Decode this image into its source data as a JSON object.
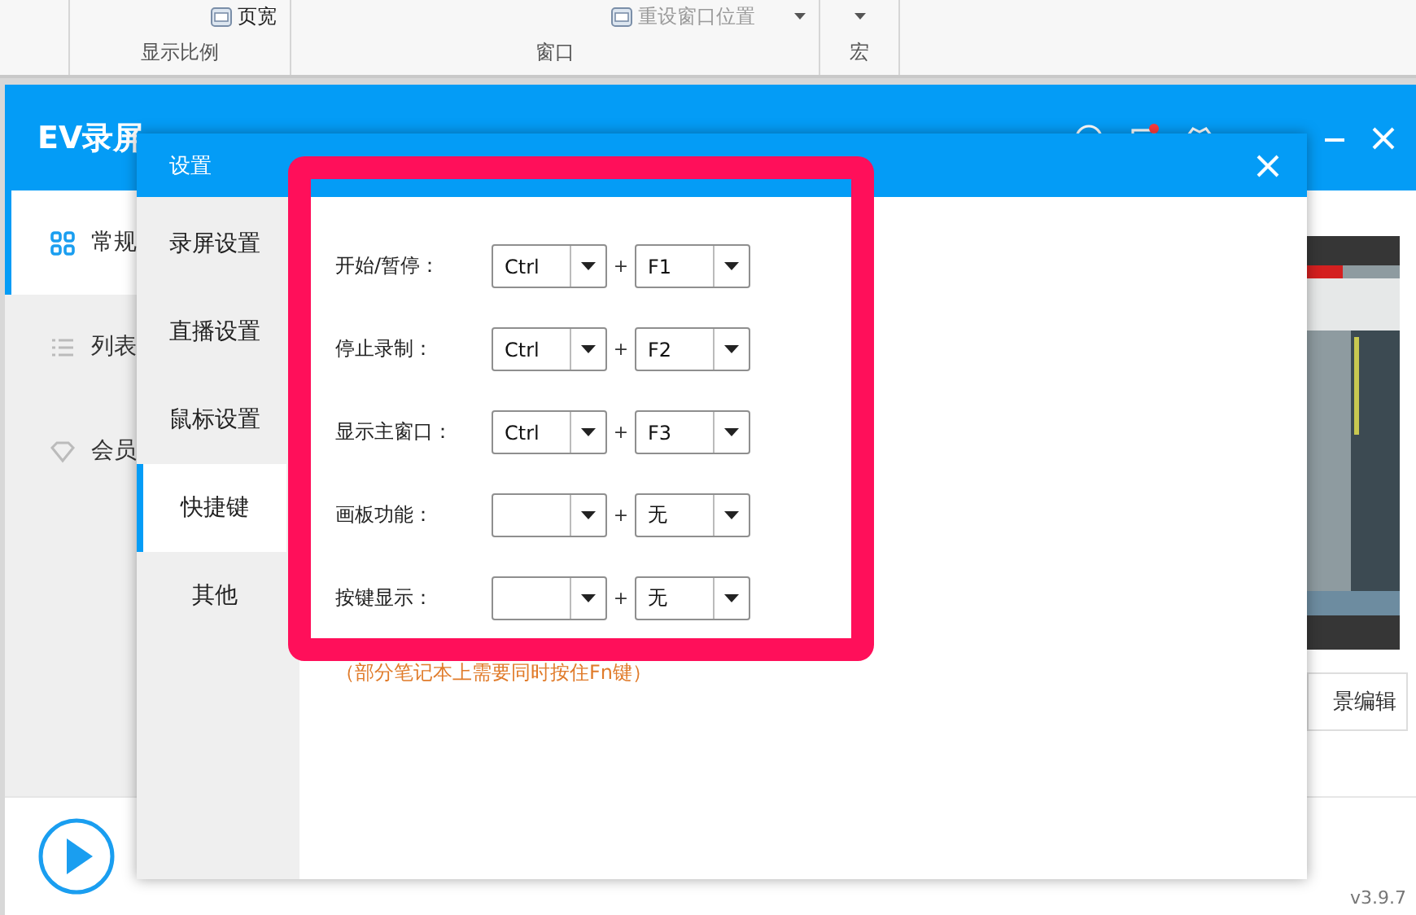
{
  "ribbon": {
    "groups": [
      {
        "label": "显示比例",
        "command": "页宽",
        "enabled": true
      },
      {
        "label": "窗口",
        "command": "重设窗口位置",
        "enabled": false,
        "dropdown": true
      },
      {
        "label": "宏",
        "dropdown": true
      }
    ]
  },
  "app": {
    "title": "EV录屏",
    "sidebar": [
      {
        "label": "常规",
        "selected": true
      },
      {
        "label": "列表",
        "selected": false
      },
      {
        "label": "会员",
        "selected": false
      }
    ],
    "edit_button": "景编辑",
    "version": "v3.9.7"
  },
  "dialog": {
    "title": "设置",
    "nav": [
      {
        "label": "录屏设置",
        "selected": false
      },
      {
        "label": "直播设置",
        "selected": false
      },
      {
        "label": "鼠标设置",
        "selected": false
      },
      {
        "label": "快捷键",
        "selected": true
      },
      {
        "label": "其他",
        "selected": false
      }
    ],
    "shortcuts": [
      {
        "label": "开始/暂停：",
        "modifier": "Ctrl",
        "plus": "+",
        "key": "F1"
      },
      {
        "label": "停止录制：",
        "modifier": "Ctrl",
        "plus": "+",
        "key": "F2"
      },
      {
        "label": "显示主窗口：",
        "modifier": "Ctrl",
        "plus": "+",
        "key": "F3"
      },
      {
        "label": "画板功能：",
        "plus": "+",
        "key": "无"
      },
      {
        "label": "按键显示：",
        "plus": "+",
        "key": "无"
      }
    ],
    "note": "（部分笔记本上需要同时按住Fn键）"
  }
}
